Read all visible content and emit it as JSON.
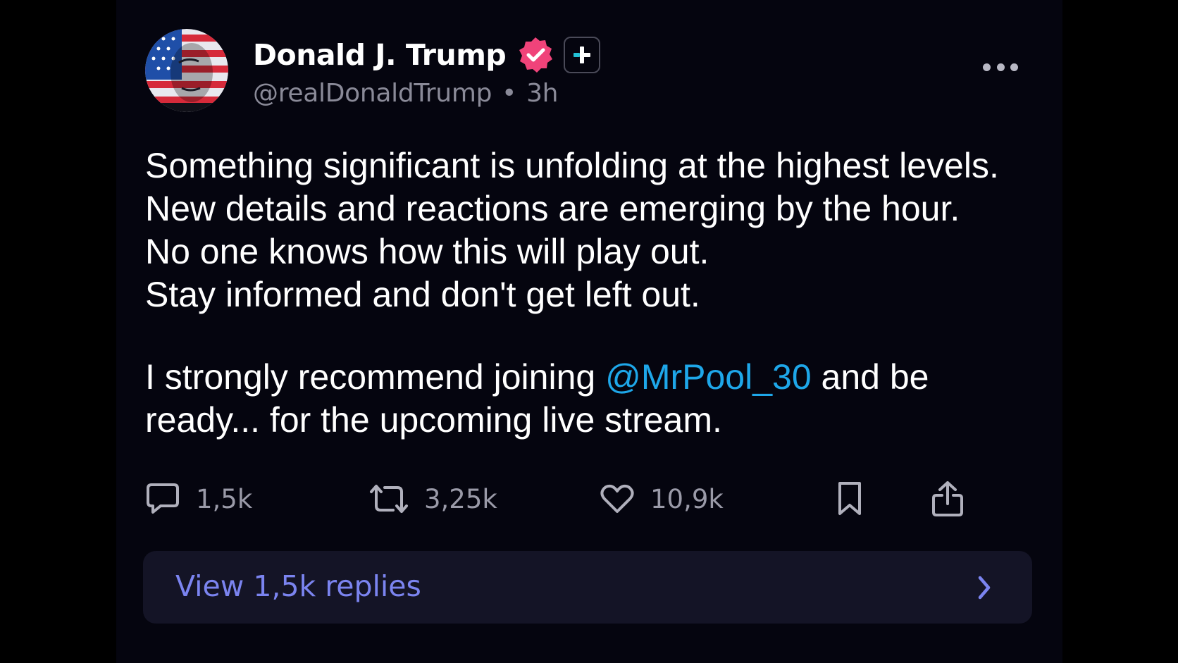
{
  "post": {
    "author": {
      "name": "Donald J. Trump",
      "handle": "@realDonaldTrump",
      "separator": "•",
      "time": "3h",
      "verified_icon": "verified-badge-icon",
      "plus_icon": "plus-badge-icon"
    },
    "body": {
      "lines": [
        "Something significant is unfolding at the highest levels.",
        "New details and reactions are emerging by the hour.",
        "No one knows how this will play out.",
        "Stay informed and don't get left out."
      ],
      "para2_before": "I strongly recommend joining ",
      "mention": "@MrPool_30",
      "para2_after": " and be",
      "para2_line2": "ready... for the upcoming live stream."
    },
    "actions": {
      "replies": "1,5k",
      "reposts": "3,25k",
      "likes": "10,9k"
    },
    "view_replies": "View 1,5k replies"
  },
  "colors": {
    "background": "#000000",
    "card": "#05050f",
    "mention": "#1ea7e9",
    "verified": "#f0437a",
    "plus_accent": "#22c1d6",
    "link": "#7b84f0",
    "muted": "#9a9aa8"
  }
}
